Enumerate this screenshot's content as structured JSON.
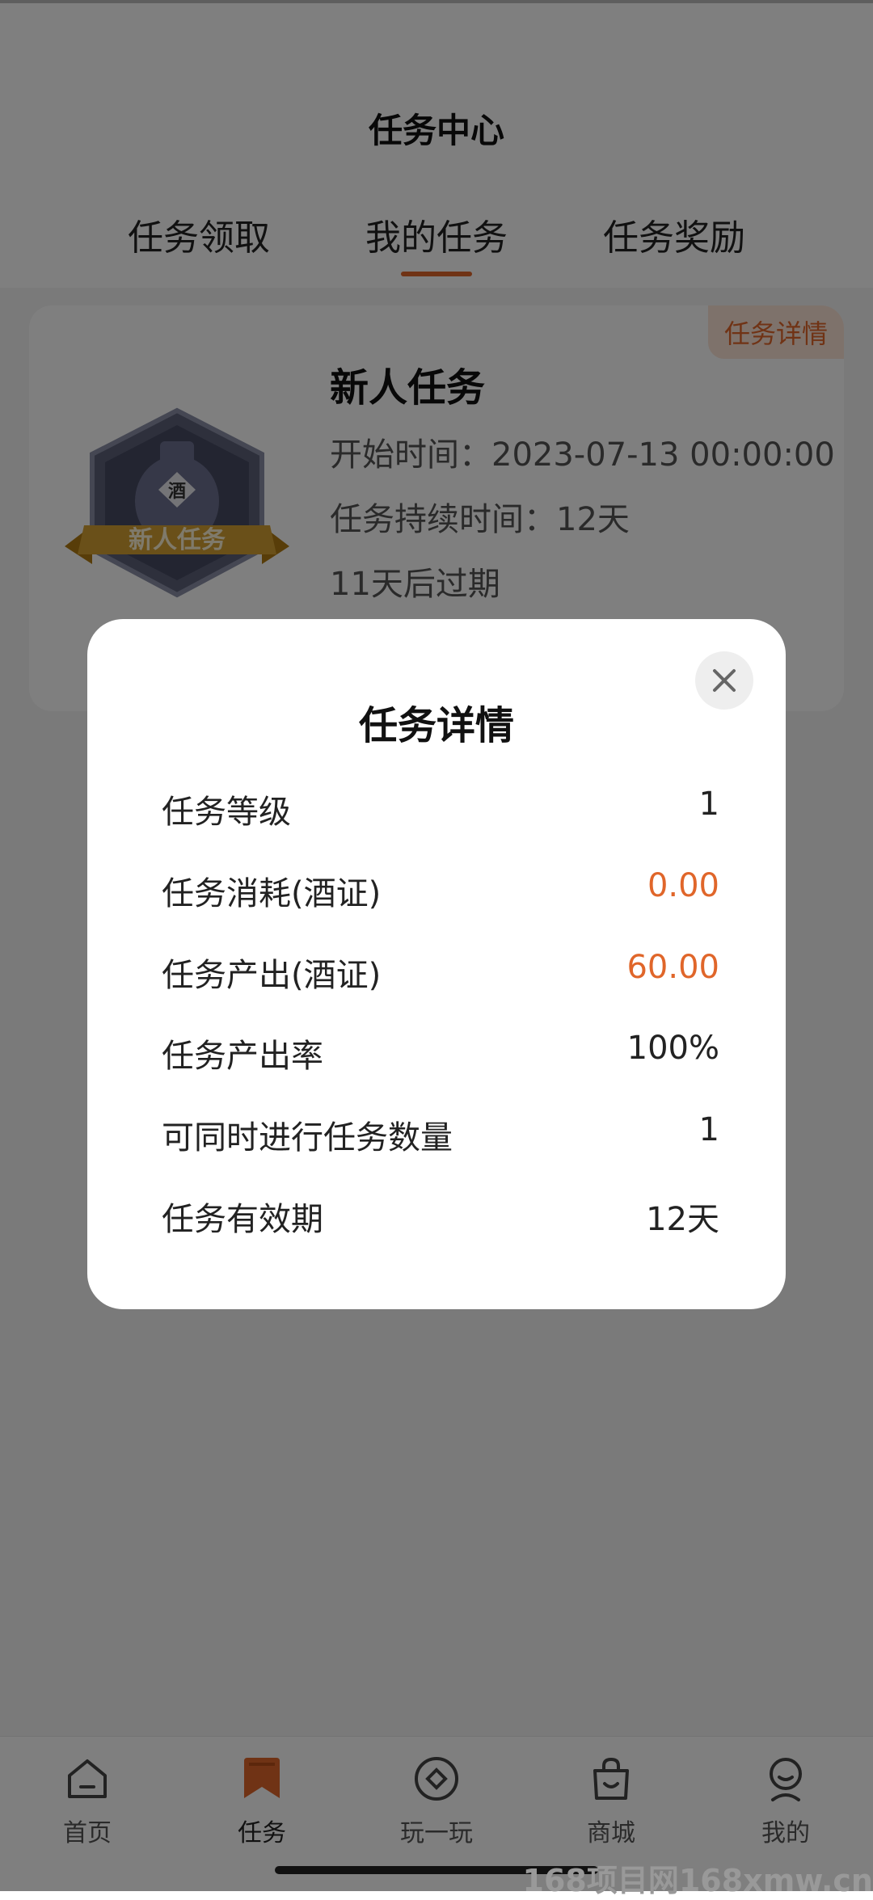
{
  "header": {
    "title": "任务中心"
  },
  "tabs": [
    {
      "label": "任务领取",
      "active": false
    },
    {
      "label": "我的任务",
      "active": true
    },
    {
      "label": "任务奖励",
      "active": false
    }
  ],
  "task_card": {
    "tag": "任务详情",
    "title": "新人任务",
    "start_time": "开始时间：2023-07-13 00:00:00",
    "duration": "任务持续时间：12天",
    "expiry": "11天后过期",
    "badge": {
      "bottle_label": "酒",
      "ribbon_label": "新人任务"
    }
  },
  "modal": {
    "title": "任务详情",
    "rows": [
      {
        "key": "任务等级",
        "value": "1"
      },
      {
        "key": "任务消耗(酒证)",
        "value": "0.00"
      },
      {
        "key": "任务产出(酒证)",
        "value": "60.00"
      },
      {
        "key": "任务产出率",
        "value": "100%"
      },
      {
        "key": "可同时进行任务数量",
        "value": "1"
      },
      {
        "key": "任务有效期",
        "value": "12天"
      }
    ]
  },
  "bottom_nav": [
    {
      "label": "首页",
      "icon": "home-icon"
    },
    {
      "label": "任务",
      "icon": "bookmark-icon",
      "active": true
    },
    {
      "label": "玩一玩",
      "icon": "play-coin-icon"
    },
    {
      "label": "商城",
      "icon": "shopping-bag-icon"
    },
    {
      "label": "我的",
      "icon": "user-icon"
    }
  ],
  "watermark": "168项目网168xmw.cn",
  "colors": {
    "accent": "#e0662a",
    "overlay": "rgba(0,0,0,0.5)"
  }
}
